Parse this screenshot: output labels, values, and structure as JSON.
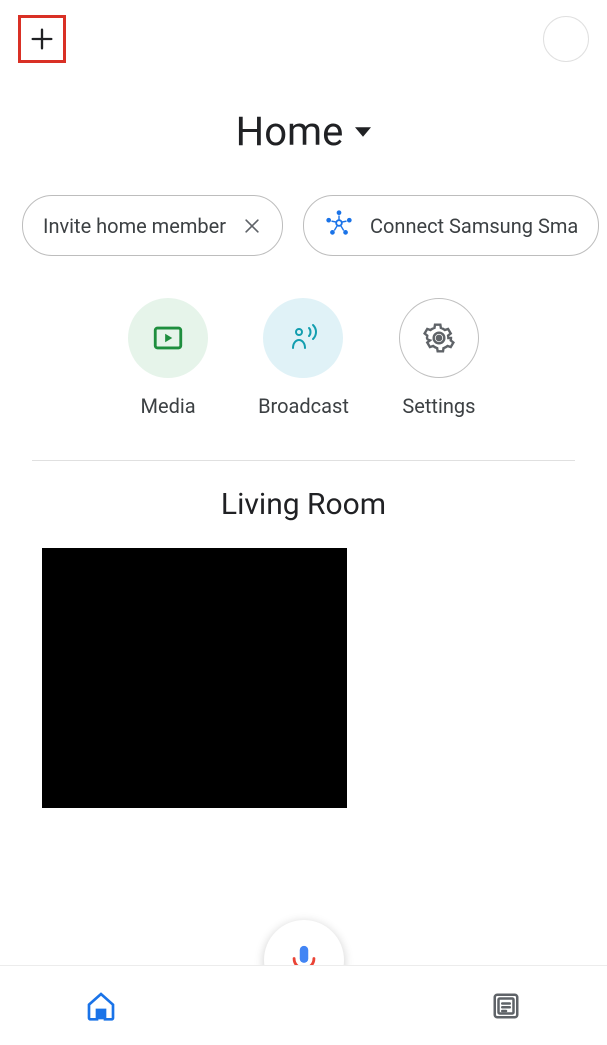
{
  "header": {
    "title": "Home"
  },
  "chips": [
    {
      "label": "Invite home member",
      "closable": true
    },
    {
      "label": "Connect Samsung Sma",
      "icon": "smartthings"
    }
  ],
  "quick_actions": [
    {
      "label": "Media",
      "style": "media"
    },
    {
      "label": "Broadcast",
      "style": "broadcast"
    },
    {
      "label": "Settings",
      "style": "settings"
    }
  ],
  "room": {
    "name": "Living Room"
  }
}
